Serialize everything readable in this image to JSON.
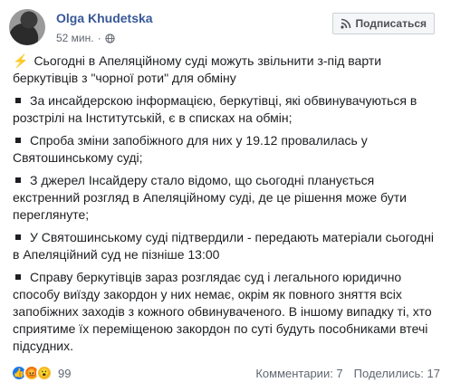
{
  "post": {
    "author": "Olga Khudetska",
    "time": "52 мин.",
    "subscribe_label": "Подписаться",
    "paragraphs": [
      {
        "kind": "bolt",
        "text": "Сьогодні в Апеляційному суді можуть звільнити з-під варти беркутівців з \"чорної роти\" для обміну"
      },
      {
        "kind": "bullet",
        "text": "За инсайдерскою інформацією, беркутівці, які обвинувачуються в розстрілі на Інститутській, є в списках на обмін;"
      },
      {
        "kind": "bullet",
        "text": "Спроба зміни запобіжного для них у 19.12 провалилась у Святошинському суді;"
      },
      {
        "kind": "bullet",
        "text": "З джерел Інсайдеру стало відомо, що сьогодні планується екстренний розгляд в Апеляційному суді, де це рішення може бути переглянуте;"
      },
      {
        "kind": "bullet",
        "text": "У Святошинському суді підтвердили - передають матеріали сьогодні в Апеляційний суд не пізніше 13:00"
      },
      {
        "kind": "bullet",
        "text": "Справу беркутівців зараз розглядає суд і легального юридично способу виїзду закордон у них немає, окрім як повного зняття всіх запобіжних заходів з кожного обвинуваченого. В іншому випадку ті, хто сприятиме їх переміщеною закордон по суті будуть пособниками втечі підсудних."
      }
    ]
  },
  "footer": {
    "reaction_icons": [
      "like-icon",
      "angry-icon",
      "wow-icon"
    ],
    "reaction_count": "99",
    "comments": "Комментарии: 7",
    "shares": "Поделились: 17"
  },
  "colors": {
    "author": "#385898",
    "text": "#1c1e21",
    "muted": "#606770",
    "like": "#1877f2"
  }
}
